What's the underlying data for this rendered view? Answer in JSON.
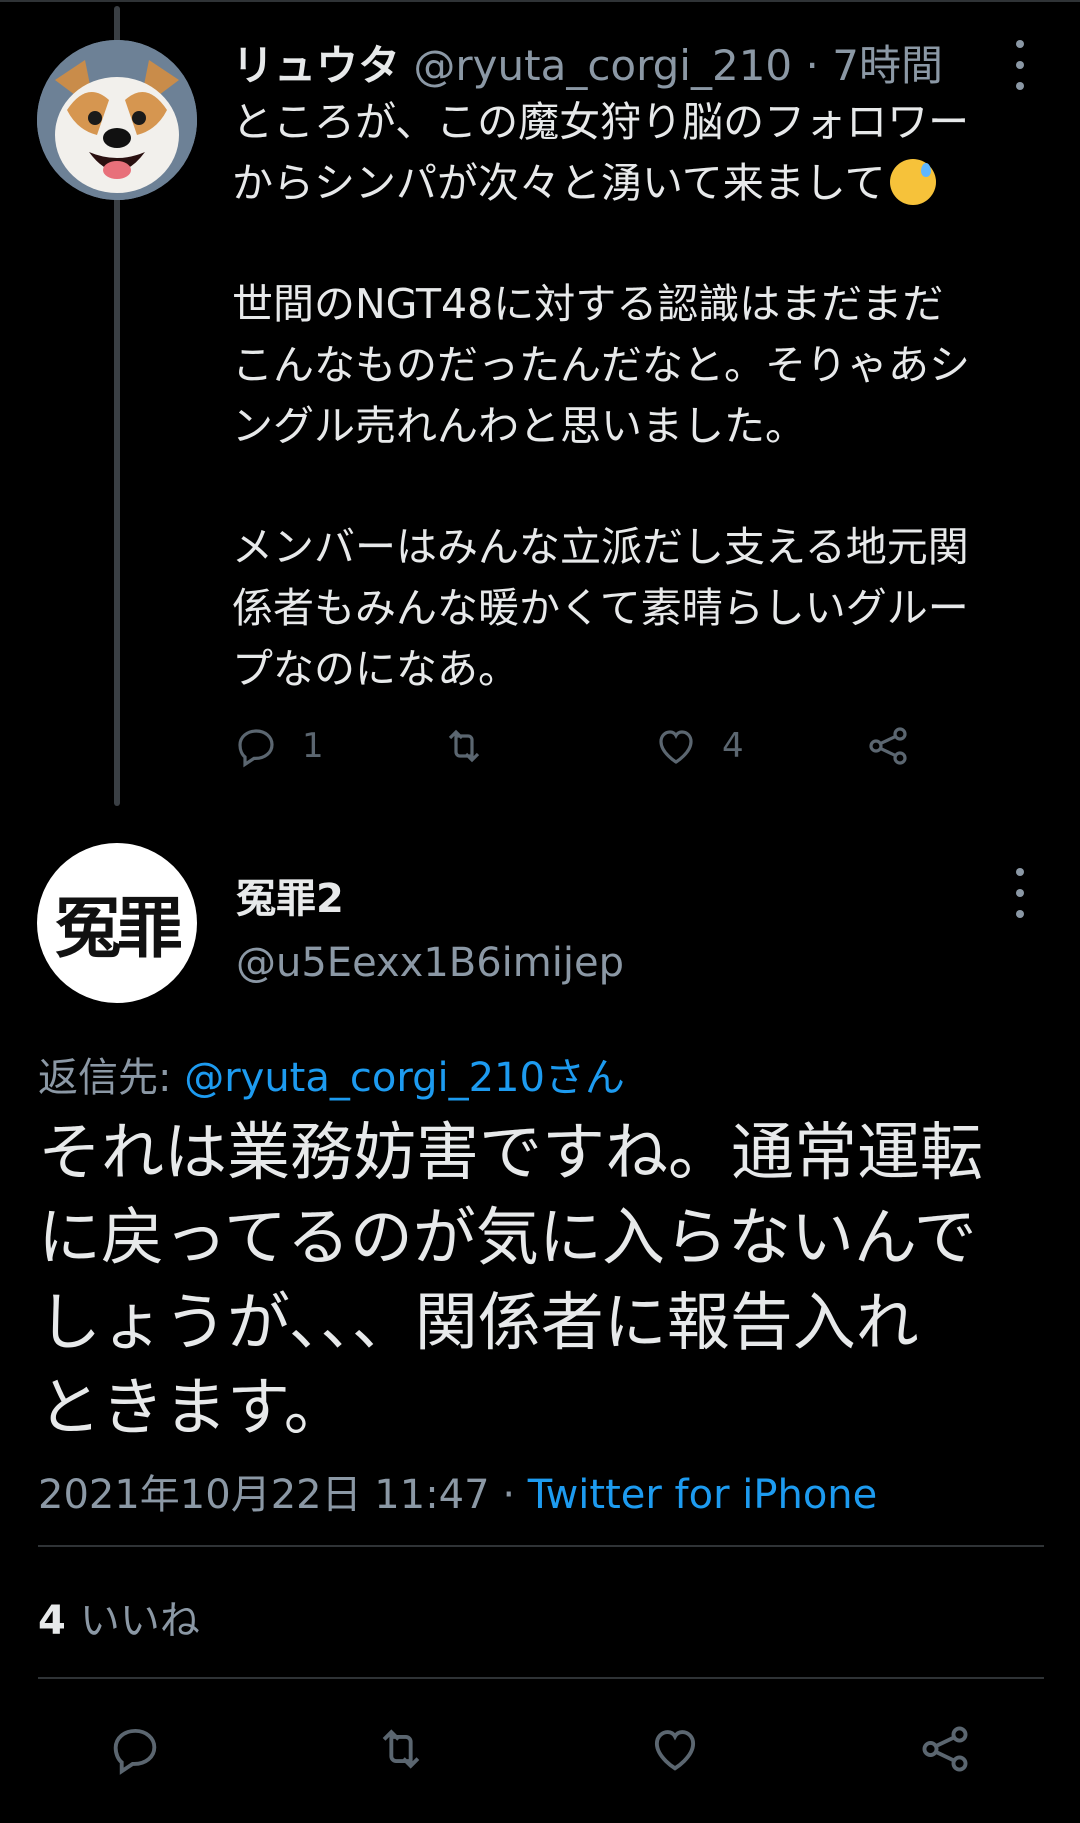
{
  "tweet1": {
    "display_name": "リュウタ",
    "handle": "@ryuta_corgi_210",
    "separator": "·",
    "time": "7時間",
    "avatar_icon": "corgi-avatar",
    "lines": [
      "ところが、この魔女狩り脳のフォロワー",
      "からシンパが次々と湧いて来まして"
    ],
    "emoji": "sweat-smile-emoji",
    "paragraph2": [
      "世間のNGT48に対する認識はまだまだ",
      "こんなものだったんだなと。そりゃあシ",
      "ングル売れんわと思いました。"
    ],
    "paragraph3": [
      "メンバーはみんな立派だし支える地元関",
      "係者もみんな暖かくて素晴らしいグルー",
      "プなのになあ。"
    ],
    "reply_count": "1",
    "like_count": "4"
  },
  "tweet2": {
    "avatar_text": "冤罪",
    "display_name": "冤罪2",
    "handle": "@u5Eexx1B6imijep",
    "reply_label": "返信先:",
    "reply_target": "@ryuta_corgi_210さん",
    "body_lines": [
      "それは業務妨害ですね。通常運転",
      "に戻ってるのが気に入らないんで",
      "しょうが、、、関係者に報告入れ",
      "ときます。"
    ],
    "timestamp": "2021年10月22日 11:47",
    "separator": "·",
    "source": "Twitter for iPhone",
    "likes_count": "4",
    "likes_label": "いいね"
  },
  "colors": {
    "background": "#000000",
    "text": "#e7e9ea",
    "muted": "#8b98a5",
    "link": "#1d9bf0",
    "divider": "#2f3336"
  }
}
